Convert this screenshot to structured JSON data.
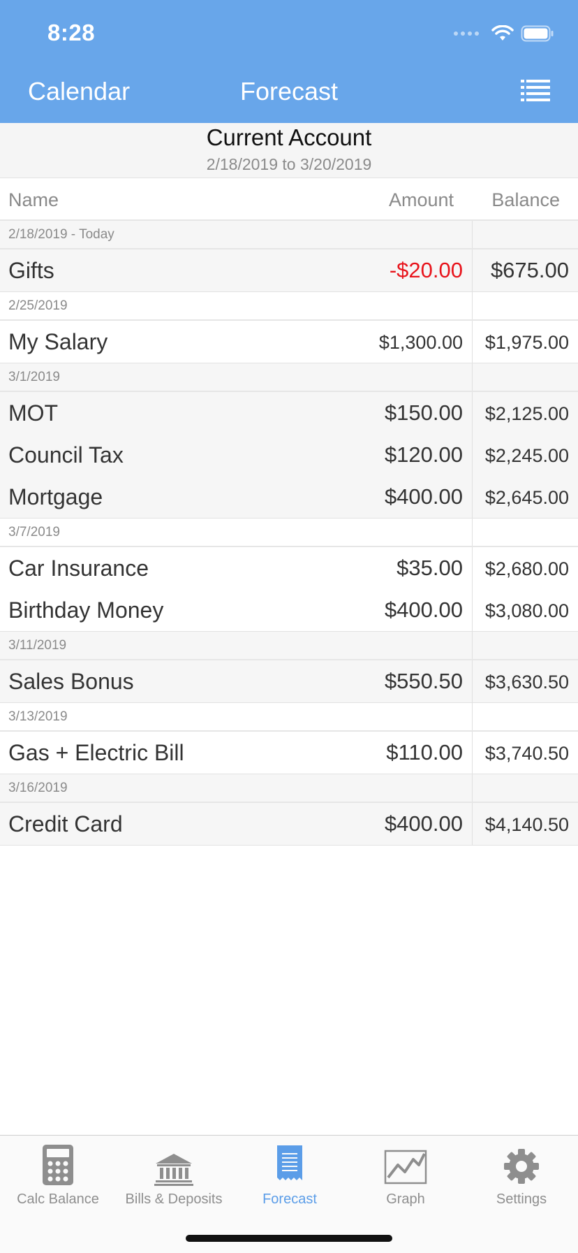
{
  "status_bar": {
    "time": "8:28"
  },
  "nav": {
    "left_label": "Calendar",
    "title": "Forecast",
    "right_icon": "list-icon"
  },
  "account": {
    "name": "Current Account",
    "range": "2/18/2019 to 3/20/2019"
  },
  "columns": {
    "name": "Name",
    "amount": "Amount",
    "balance": "Balance"
  },
  "groups": [
    {
      "date": "2/18/2019 - Today",
      "shade": "shaded",
      "rows": [
        {
          "name": "Gifts",
          "amount": "-$20.00",
          "balance": "$675.00"
        }
      ]
    },
    {
      "date": "2/25/2019",
      "shade": "plain",
      "rows": [
        {
          "name": "My Salary",
          "amount": "$1,300.00",
          "balance": "$1,975.00"
        }
      ]
    },
    {
      "date": "3/1/2019",
      "shade": "shaded",
      "rows": [
        {
          "name": "MOT",
          "amount": "$150.00",
          "balance": "$2,125.00"
        },
        {
          "name": "Council Tax",
          "amount": "$120.00",
          "balance": "$2,245.00"
        },
        {
          "name": "Mortgage",
          "amount": "$400.00",
          "balance": "$2,645.00"
        }
      ]
    },
    {
      "date": "3/7/2019",
      "shade": "plain",
      "rows": [
        {
          "name": "Car Insurance",
          "amount": "$35.00",
          "balance": "$2,680.00"
        },
        {
          "name": "Birthday Money",
          "amount": "$400.00",
          "balance": "$3,080.00"
        }
      ]
    },
    {
      "date": "3/11/2019",
      "shade": "shaded",
      "rows": [
        {
          "name": "Sales Bonus",
          "amount": "$550.50",
          "balance": "$3,630.50"
        }
      ]
    },
    {
      "date": "3/13/2019",
      "shade": "plain",
      "rows": [
        {
          "name": "Gas + Electric Bill",
          "amount": "$110.00",
          "balance": "$3,740.50"
        }
      ]
    },
    {
      "date": "3/16/2019",
      "shade": "shaded",
      "rows": [
        {
          "name": "Credit Card",
          "amount": "$400.00",
          "balance": "$4,140.50"
        }
      ]
    }
  ],
  "tabs": [
    {
      "label": "Calc Balance",
      "icon": "calculator-icon",
      "active": false
    },
    {
      "label": "Bills & Deposits",
      "icon": "bank-icon",
      "active": false
    },
    {
      "label": "Forecast",
      "icon": "receipt-icon",
      "active": true
    },
    {
      "label": "Graph",
      "icon": "graph-icon",
      "active": false
    },
    {
      "label": "Settings",
      "icon": "gear-icon",
      "active": false
    }
  ],
  "colors": {
    "header": "#68a6ea",
    "negative": "#e8141c",
    "active_tab": "#5b9de8",
    "inactive_tab": "#8e8e8e"
  }
}
